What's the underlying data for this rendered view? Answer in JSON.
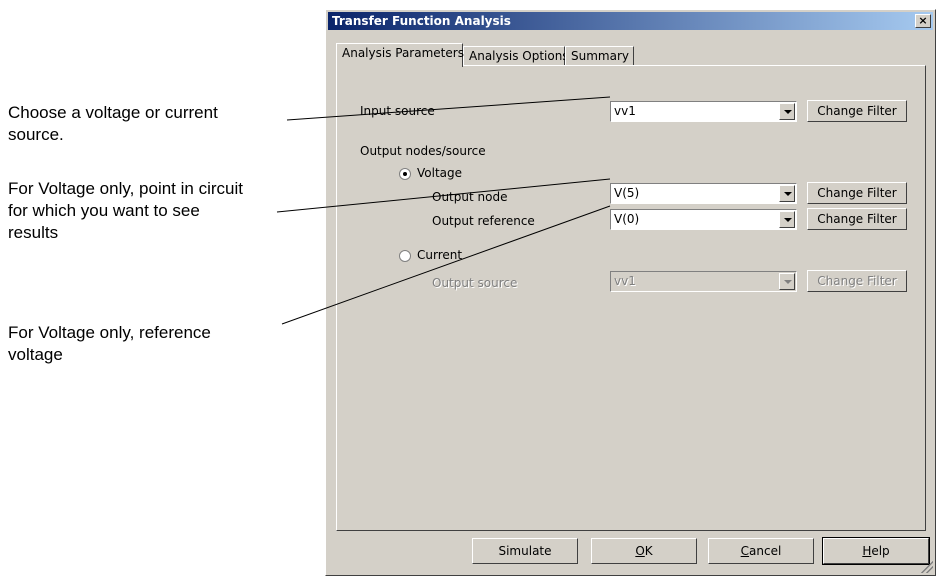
{
  "annotations": {
    "choose_source": [
      "Choose a voltage or current",
      "source."
    ],
    "voltage_point": [
      "For Voltage only, point in circuit",
      "for which you want to see",
      "results"
    ],
    "reference_voltage": [
      "For Voltage only, reference",
      "voltage"
    ]
  },
  "dialog": {
    "title": "Transfer Function Analysis",
    "close_glyph": "×",
    "tabs": [
      "Analysis Parameters",
      "Analysis Options",
      "Summary"
    ],
    "input_source": {
      "label": "Input source",
      "value": "vv1",
      "button": "Change Filter"
    },
    "output_group_label": "Output nodes/source",
    "voltage": {
      "label": "Voltage",
      "selected": true,
      "output_node": {
        "label": "Output node",
        "value": "V(5)",
        "button": "Change Filter"
      },
      "output_reference": {
        "label": "Output reference",
        "value": "V(0)",
        "button": "Change Filter"
      }
    },
    "current": {
      "label": "Current",
      "selected": false,
      "output_source": {
        "label": "Output source",
        "value": "vv1",
        "button": "Change Filter"
      }
    },
    "buttons": {
      "simulate": "Simulate",
      "ok_mnemonic": "O",
      "ok_rest": "K",
      "cancel_mnemonic": "C",
      "cancel_rest": "ancel",
      "help_mnemonic": "H",
      "help_rest": "elp"
    }
  },
  "colors": {
    "face": "#d4d0c8",
    "title_start": "#0a246a",
    "title_end": "#a6caf0",
    "disabled_text": "#808080"
  }
}
